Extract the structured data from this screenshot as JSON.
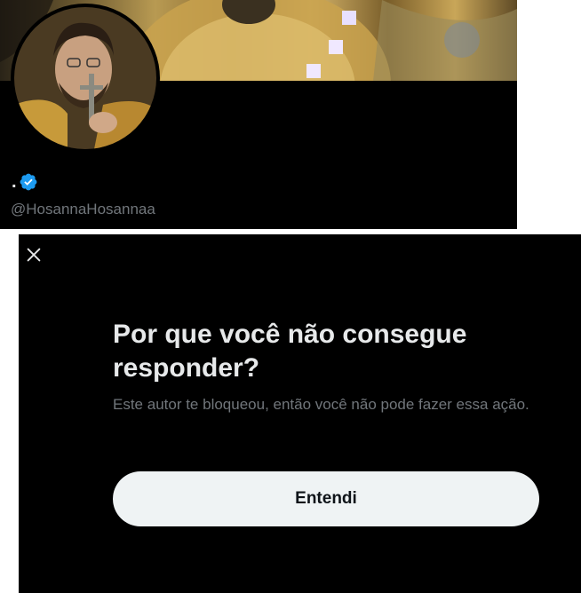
{
  "profile": {
    "display_name": ".",
    "handle": "@HosannaHosannaa",
    "verified": true,
    "verified_color": "#1d9bf0"
  },
  "modal": {
    "title": "Por que você não consegue responder?",
    "description": "Este autor te bloqueou, então você não pode fazer essa ação.",
    "button_label": "Entendi"
  },
  "icons": {
    "close": "close-icon",
    "verified": "verified-badge-icon"
  },
  "colors": {
    "background": "#000000",
    "text_primary": "#e7e9ea",
    "text_secondary": "#71767b",
    "button_bg": "#eff3f4",
    "button_text": "#0f1419"
  }
}
